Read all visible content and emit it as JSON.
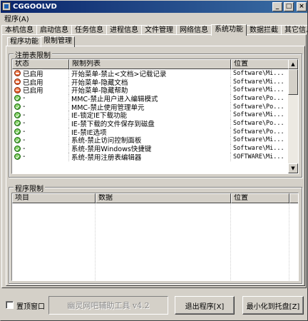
{
  "window": {
    "title": "CGGOOLVD"
  },
  "menu": {
    "items": [
      "程序(A)"
    ]
  },
  "tabs": [
    "本机信息",
    "启动信息",
    "任务信息",
    "进程信息",
    "文件管理",
    "网络信息",
    "系统功能",
    "数据拦截",
    "其它信息"
  ],
  "active_tab": 6,
  "subtabs": [
    "程序功能",
    "限制管理"
  ],
  "active_subtab": 1,
  "registry_group": {
    "title": "注册表限制",
    "columns": [
      "状态",
      "限制列表",
      "位置"
    ],
    "rows": [
      {
        "icon": "disabled-icon",
        "status": "已启用",
        "name": "开始菜单-禁止<文档>记载记录",
        "location": "Software\\Mi..."
      },
      {
        "icon": "disabled-icon",
        "status": "已启用",
        "name": "开始菜单-隐藏文档",
        "location": "Software\\Mi..."
      },
      {
        "icon": "disabled-icon",
        "status": "已启用",
        "name": "开始菜单-隐藏帮助",
        "location": "Software\\Mi..."
      },
      {
        "icon": "ok-icon",
        "status": "-",
        "name": "MMC-禁止用户进入编辑模式",
        "location": "Software\\Po..."
      },
      {
        "icon": "ok-icon",
        "status": "-",
        "name": "MMC-禁止使用管理单元",
        "location": "Software\\Po..."
      },
      {
        "icon": "ok-icon",
        "status": "-",
        "name": "IE-锁定IE下载功能",
        "location": "Software\\Mi..."
      },
      {
        "icon": "ok-icon",
        "status": "-",
        "name": "IE-禁下载的文件保存到磁盘",
        "location": "Software\\Po..."
      },
      {
        "icon": "ok-icon",
        "status": "-",
        "name": "IE-禁IE选项",
        "location": "Software\\Po..."
      },
      {
        "icon": "ok-icon",
        "status": "-",
        "name": "系统-禁止访问控制面板",
        "location": "Software\\Mi..."
      },
      {
        "icon": "ok-icon",
        "status": "-",
        "name": "系统-禁用Windows快捷键",
        "location": "Software\\Mi..."
      },
      {
        "icon": "ok-icon",
        "status": "-",
        "name": "系统-禁用注册表编辑器",
        "location": "SOFTWARE\\Mi..."
      }
    ]
  },
  "program_group": {
    "title": "程序限制",
    "columns": [
      "项目",
      "数据",
      "位置"
    ],
    "rows": []
  },
  "bottom": {
    "topmost_label": "置顶窗口",
    "topmost_checked": false,
    "brand": "幽灵网吧辅助工具  v4.2",
    "exit_button": "退出程序[X]",
    "tray_button": "最小化到托盘[Z]"
  },
  "colors": {
    "title_start": "#0a246a",
    "title_end": "#3a6ea5",
    "face": "#d4d0c8"
  }
}
